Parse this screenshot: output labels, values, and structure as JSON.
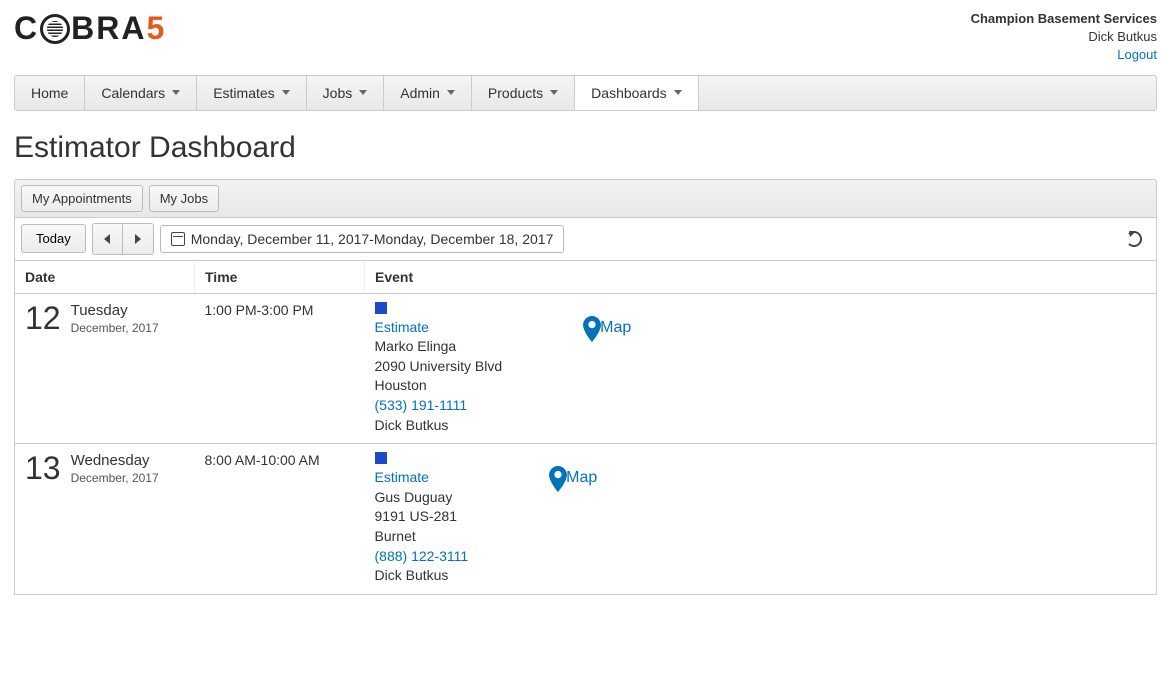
{
  "header": {
    "logo_text_1": "C",
    "logo_text_2": "BRA",
    "logo_text_3": "5",
    "company": "Champion Basement Services",
    "user": "Dick Butkus",
    "logout_label": "Logout"
  },
  "nav": {
    "items": [
      {
        "label": "Home",
        "dropdown": false
      },
      {
        "label": "Calendars",
        "dropdown": true
      },
      {
        "label": "Estimates",
        "dropdown": true
      },
      {
        "label": "Jobs",
        "dropdown": true
      },
      {
        "label": "Admin",
        "dropdown": true
      },
      {
        "label": "Products",
        "dropdown": true
      },
      {
        "label": "Dashboards",
        "dropdown": true
      }
    ]
  },
  "page_title": "Estimator Dashboard",
  "tabs": {
    "appointments": "My Appointments",
    "jobs": "My Jobs"
  },
  "toolbar": {
    "today_label": "Today",
    "date_range": "Monday, December 11, 2017-Monday, December 18, 2017"
  },
  "columns": {
    "date": "Date",
    "time": "Time",
    "event": "Event"
  },
  "rows": [
    {
      "day_num": "12",
      "weekday": "Tuesday",
      "monthyear": "December, 2017",
      "time": "1:00 PM-3:00 PM",
      "event": {
        "type": "Estimate",
        "name": "Marko Elinga",
        "addr1": "2090 University Blvd",
        "city": "Houston",
        "phone": "(533) 191-1111",
        "rep": "Dick Butkus",
        "map_label": "Map"
      }
    },
    {
      "day_num": "13",
      "weekday": "Wednesday",
      "monthyear": "December, 2017",
      "time": "8:00 AM-10:00 AM",
      "event": {
        "type": "Estimate",
        "name": "Gus Duguay",
        "addr1": "9191 US-281",
        "city": "Burnet",
        "phone": "(888) 122-3111",
        "rep": "Dick Butkus",
        "map_label": "Map"
      }
    }
  ]
}
